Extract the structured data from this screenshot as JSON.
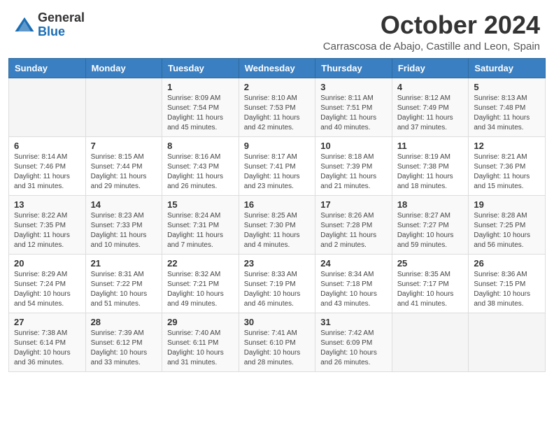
{
  "logo": {
    "general": "General",
    "blue": "Blue"
  },
  "header": {
    "month": "October 2024",
    "location": "Carrascosa de Abajo, Castille and Leon, Spain"
  },
  "days_of_week": [
    "Sunday",
    "Monday",
    "Tuesday",
    "Wednesday",
    "Thursday",
    "Friday",
    "Saturday"
  ],
  "weeks": [
    [
      {
        "day": "",
        "info": ""
      },
      {
        "day": "",
        "info": ""
      },
      {
        "day": "1",
        "info": "Sunrise: 8:09 AM\nSunset: 7:54 PM\nDaylight: 11 hours and 45 minutes."
      },
      {
        "day": "2",
        "info": "Sunrise: 8:10 AM\nSunset: 7:53 PM\nDaylight: 11 hours and 42 minutes."
      },
      {
        "day": "3",
        "info": "Sunrise: 8:11 AM\nSunset: 7:51 PM\nDaylight: 11 hours and 40 minutes."
      },
      {
        "day": "4",
        "info": "Sunrise: 8:12 AM\nSunset: 7:49 PM\nDaylight: 11 hours and 37 minutes."
      },
      {
        "day": "5",
        "info": "Sunrise: 8:13 AM\nSunset: 7:48 PM\nDaylight: 11 hours and 34 minutes."
      }
    ],
    [
      {
        "day": "6",
        "info": "Sunrise: 8:14 AM\nSunset: 7:46 PM\nDaylight: 11 hours and 31 minutes."
      },
      {
        "day": "7",
        "info": "Sunrise: 8:15 AM\nSunset: 7:44 PM\nDaylight: 11 hours and 29 minutes."
      },
      {
        "day": "8",
        "info": "Sunrise: 8:16 AM\nSunset: 7:43 PM\nDaylight: 11 hours and 26 minutes."
      },
      {
        "day": "9",
        "info": "Sunrise: 8:17 AM\nSunset: 7:41 PM\nDaylight: 11 hours and 23 minutes."
      },
      {
        "day": "10",
        "info": "Sunrise: 8:18 AM\nSunset: 7:39 PM\nDaylight: 11 hours and 21 minutes."
      },
      {
        "day": "11",
        "info": "Sunrise: 8:19 AM\nSunset: 7:38 PM\nDaylight: 11 hours and 18 minutes."
      },
      {
        "day": "12",
        "info": "Sunrise: 8:21 AM\nSunset: 7:36 PM\nDaylight: 11 hours and 15 minutes."
      }
    ],
    [
      {
        "day": "13",
        "info": "Sunrise: 8:22 AM\nSunset: 7:35 PM\nDaylight: 11 hours and 12 minutes."
      },
      {
        "day": "14",
        "info": "Sunrise: 8:23 AM\nSunset: 7:33 PM\nDaylight: 11 hours and 10 minutes."
      },
      {
        "day": "15",
        "info": "Sunrise: 8:24 AM\nSunset: 7:31 PM\nDaylight: 11 hours and 7 minutes."
      },
      {
        "day": "16",
        "info": "Sunrise: 8:25 AM\nSunset: 7:30 PM\nDaylight: 11 hours and 4 minutes."
      },
      {
        "day": "17",
        "info": "Sunrise: 8:26 AM\nSunset: 7:28 PM\nDaylight: 11 hours and 2 minutes."
      },
      {
        "day": "18",
        "info": "Sunrise: 8:27 AM\nSunset: 7:27 PM\nDaylight: 10 hours and 59 minutes."
      },
      {
        "day": "19",
        "info": "Sunrise: 8:28 AM\nSunset: 7:25 PM\nDaylight: 10 hours and 56 minutes."
      }
    ],
    [
      {
        "day": "20",
        "info": "Sunrise: 8:29 AM\nSunset: 7:24 PM\nDaylight: 10 hours and 54 minutes."
      },
      {
        "day": "21",
        "info": "Sunrise: 8:31 AM\nSunset: 7:22 PM\nDaylight: 10 hours and 51 minutes."
      },
      {
        "day": "22",
        "info": "Sunrise: 8:32 AM\nSunset: 7:21 PM\nDaylight: 10 hours and 49 minutes."
      },
      {
        "day": "23",
        "info": "Sunrise: 8:33 AM\nSunset: 7:19 PM\nDaylight: 10 hours and 46 minutes."
      },
      {
        "day": "24",
        "info": "Sunrise: 8:34 AM\nSunset: 7:18 PM\nDaylight: 10 hours and 43 minutes."
      },
      {
        "day": "25",
        "info": "Sunrise: 8:35 AM\nSunset: 7:17 PM\nDaylight: 10 hours and 41 minutes."
      },
      {
        "day": "26",
        "info": "Sunrise: 8:36 AM\nSunset: 7:15 PM\nDaylight: 10 hours and 38 minutes."
      }
    ],
    [
      {
        "day": "27",
        "info": "Sunrise: 7:38 AM\nSunset: 6:14 PM\nDaylight: 10 hours and 36 minutes."
      },
      {
        "day": "28",
        "info": "Sunrise: 7:39 AM\nSunset: 6:12 PM\nDaylight: 10 hours and 33 minutes."
      },
      {
        "day": "29",
        "info": "Sunrise: 7:40 AM\nSunset: 6:11 PM\nDaylight: 10 hours and 31 minutes."
      },
      {
        "day": "30",
        "info": "Sunrise: 7:41 AM\nSunset: 6:10 PM\nDaylight: 10 hours and 28 minutes."
      },
      {
        "day": "31",
        "info": "Sunrise: 7:42 AM\nSunset: 6:09 PM\nDaylight: 10 hours and 26 minutes."
      },
      {
        "day": "",
        "info": ""
      },
      {
        "day": "",
        "info": ""
      }
    ]
  ]
}
